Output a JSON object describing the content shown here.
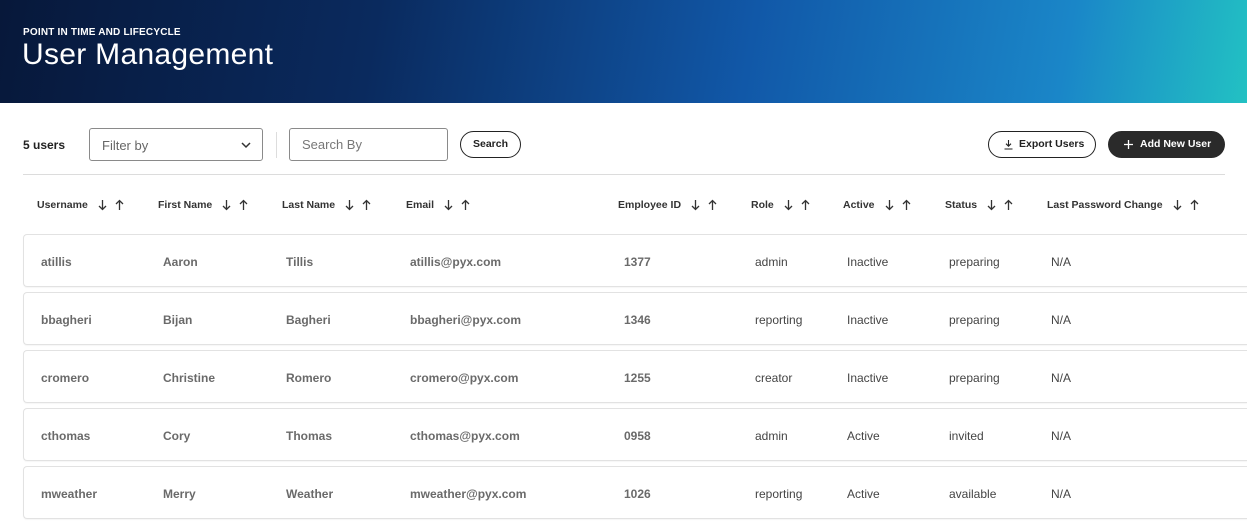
{
  "header": {
    "eyebrow": "POINT IN TIME AND LIFECYCLE",
    "title": "User Management"
  },
  "toolbar": {
    "count": "5 users",
    "filter_label": "Filter by",
    "search_placeholder": "Search By",
    "search_label": "Search",
    "export_label": "Export Users",
    "add_label": "Add New User"
  },
  "columns": [
    "Username",
    "First Name",
    "Last Name",
    "Email",
    "Employee ID",
    "Role",
    "Active",
    "Status",
    "Last Password Change"
  ],
  "rows": [
    {
      "username": "atillis",
      "first": "Aaron",
      "last": "Tillis",
      "email": "atillis@pyx.com",
      "id": "1377",
      "role": "admin",
      "active": "Inactive",
      "status": "preparing",
      "pwd": "N/A"
    },
    {
      "username": "bbagheri",
      "first": "Bijan",
      "last": "Bagheri",
      "email": "bbagheri@pyx.com",
      "id": "1346",
      "role": "reporting",
      "active": "Inactive",
      "status": "preparing",
      "pwd": "N/A"
    },
    {
      "username": "cromero",
      "first": "Christine",
      "last": "Romero",
      "email": "cromero@pyx.com",
      "id": "1255",
      "role": "creator",
      "active": "Inactive",
      "status": "preparing",
      "pwd": "N/A"
    },
    {
      "username": "cthomas",
      "first": "Cory",
      "last": "Thomas",
      "email": "cthomas@pyx.com",
      "id": "0958",
      "role": "admin",
      "active": "Active",
      "status": "invited",
      "pwd": "N/A"
    },
    {
      "username": "mweather",
      "first": "Merry",
      "last": "Weather",
      "email": "mweather@pyx.com",
      "id": "1026",
      "role": "reporting",
      "active": "Active",
      "status": "available",
      "pwd": "N/A"
    }
  ],
  "icons": {
    "filter_dropdown": "chevron-down-icon",
    "export": "download-icon",
    "add": "plus-icon",
    "sort_desc": "arrow-down-icon",
    "sort_asc": "arrow-up-icon"
  },
  "colors": {
    "header_start": "#07183a",
    "header_end": "#22c1c3",
    "primary_button": "#2a2a2a"
  }
}
